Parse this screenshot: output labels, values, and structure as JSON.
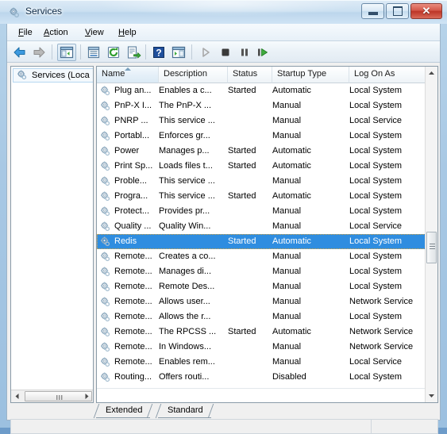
{
  "window": {
    "title": "Services",
    "icon": "services-gear-icon",
    "controls": {
      "minimize": "Minimize",
      "maximize": "Maximize",
      "close": "Close",
      "close_glyph": "✕"
    },
    "accent_selection": "#2f8de0",
    "close_button_color": "#bc3527"
  },
  "menubar": {
    "items": [
      {
        "label": "File",
        "accel": "F"
      },
      {
        "label": "Action",
        "accel": "A"
      },
      {
        "label": "View",
        "accel": "V"
      },
      {
        "label": "Help",
        "accel": "H"
      }
    ]
  },
  "toolbar": {
    "buttons": [
      {
        "name": "back-arrow-icon",
        "label": "Back",
        "enabled": true
      },
      {
        "name": "forward-arrow-icon",
        "label": "Forward",
        "enabled": false
      },
      {
        "name": "show-hide-console-tree-icon",
        "label": "Show/Hide Console Tree",
        "pressed": true
      },
      {
        "name": "properties-icon",
        "label": "Properties",
        "enabled": true
      },
      {
        "name": "refresh-icon",
        "label": "Refresh",
        "enabled": true
      },
      {
        "name": "export-list-icon",
        "label": "Export List",
        "enabled": true
      },
      {
        "name": "help-icon",
        "label": "Help",
        "enabled": true
      },
      {
        "name": "show-action-pane-icon",
        "label": "Show Action Pane",
        "enabled": true
      },
      {
        "name": "start-service-icon",
        "label": "Start Service",
        "enabled": false
      },
      {
        "name": "stop-service-icon",
        "label": "Stop Service",
        "enabled": true
      },
      {
        "name": "pause-service-icon",
        "label": "Pause Service",
        "enabled": true
      },
      {
        "name": "restart-service-icon",
        "label": "Restart Service",
        "enabled": true
      }
    ]
  },
  "tree": {
    "root": {
      "label": "Services (Loca",
      "icon": "services-gear-icon",
      "selected": true
    },
    "hscroll": {
      "thumb_label": "‖"
    }
  },
  "list": {
    "columns": [
      {
        "key": "name",
        "label": "Name",
        "sorted": true,
        "sort_dir": "asc"
      },
      {
        "key": "description",
        "label": "Description"
      },
      {
        "key": "status",
        "label": "Status"
      },
      {
        "key": "startup",
        "label": "Startup Type"
      },
      {
        "key": "logon",
        "label": "Log On As"
      }
    ],
    "rows": [
      {
        "name": "Plug an...",
        "description": "Enables a c...",
        "status": "Started",
        "startup": "Automatic",
        "logon": "Local System",
        "selected": false
      },
      {
        "name": "PnP-X I...",
        "description": "The PnP-X ...",
        "status": "",
        "startup": "Manual",
        "logon": "Local System",
        "selected": false
      },
      {
        "name": "PNRP ...",
        "description": "This service ...",
        "status": "",
        "startup": "Manual",
        "logon": "Local Service",
        "selected": false
      },
      {
        "name": "Portabl...",
        "description": "Enforces gr...",
        "status": "",
        "startup": "Manual",
        "logon": "Local System",
        "selected": false
      },
      {
        "name": "Power",
        "description": "Manages p...",
        "status": "Started",
        "startup": "Automatic",
        "logon": "Local System",
        "selected": false
      },
      {
        "name": "Print Sp...",
        "description": "Loads files t...",
        "status": "Started",
        "startup": "Automatic",
        "logon": "Local System",
        "selected": false
      },
      {
        "name": "Proble...",
        "description": "This service ...",
        "status": "",
        "startup": "Manual",
        "logon": "Local System",
        "selected": false
      },
      {
        "name": "Progra...",
        "description": "This service ...",
        "status": "Started",
        "startup": "Automatic",
        "logon": "Local System",
        "selected": false
      },
      {
        "name": "Protect...",
        "description": "Provides pr...",
        "status": "",
        "startup": "Manual",
        "logon": "Local System",
        "selected": false
      },
      {
        "name": "Quality ...",
        "description": "Quality Win...",
        "status": "",
        "startup": "Manual",
        "logon": "Local Service",
        "selected": false
      },
      {
        "name": "Redis",
        "description": "",
        "status": "Started",
        "startup": "Automatic",
        "logon": "Local System",
        "selected": true
      },
      {
        "name": "Remote...",
        "description": "Creates a co...",
        "status": "",
        "startup": "Manual",
        "logon": "Local System",
        "selected": false
      },
      {
        "name": "Remote...",
        "description": "Manages di...",
        "status": "",
        "startup": "Manual",
        "logon": "Local System",
        "selected": false
      },
      {
        "name": "Remote...",
        "description": "Remote Des...",
        "status": "",
        "startup": "Manual",
        "logon": "Local System",
        "selected": false
      },
      {
        "name": "Remote...",
        "description": "Allows user...",
        "status": "",
        "startup": "Manual",
        "logon": "Network Service",
        "selected": false
      },
      {
        "name": "Remote...",
        "description": "Allows the r...",
        "status": "",
        "startup": "Manual",
        "logon": "Local System",
        "selected": false
      },
      {
        "name": "Remote...",
        "description": "The RPCSS ...",
        "status": "Started",
        "startup": "Automatic",
        "logon": "Network Service",
        "selected": false
      },
      {
        "name": "Remote...",
        "description": "In Windows...",
        "status": "",
        "startup": "Manual",
        "logon": "Network Service",
        "selected": false
      },
      {
        "name": "Remote...",
        "description": "Enables rem...",
        "status": "",
        "startup": "Manual",
        "logon": "Local Service",
        "selected": false
      },
      {
        "name": "Routing...",
        "description": "Offers routi...",
        "status": "",
        "startup": "Disabled",
        "logon": "Local System",
        "selected": false
      }
    ]
  },
  "tabs": [
    {
      "label": "Extended",
      "active": false
    },
    {
      "label": "Standard",
      "active": true
    }
  ],
  "statusbar": {
    "left_text": "",
    "right_text": ""
  }
}
